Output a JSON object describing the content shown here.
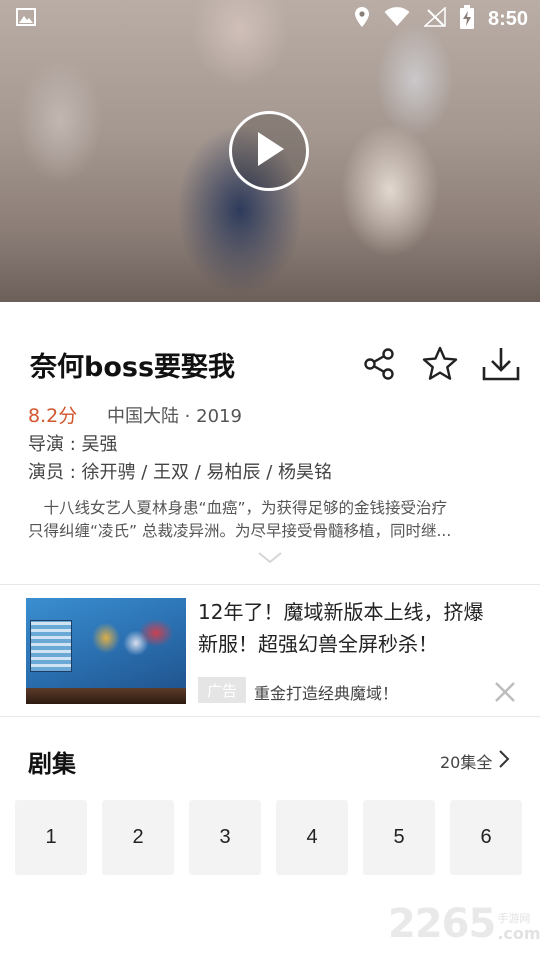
{
  "status_bar": {
    "time": "8:50",
    "icons": [
      "image-icon",
      "location-icon",
      "wifi-icon",
      "no-signal-icon",
      "battery-charging-icon"
    ]
  },
  "video": {
    "play_icon": "play-icon"
  },
  "show": {
    "title": "奈何boss要娶我",
    "rating": "8.2分",
    "region_year": "中国大陆 · 2019",
    "director": "导演 : 吴强",
    "cast": "演员 : 徐开骋 / 王双 / 易柏辰 / 杨昊铭",
    "description_line1": "　十八线女艺人夏林身患“血癌”，为获得足够的金钱接受治疗",
    "description_line2": "只得纠缠“凌氏” 总裁凌异洲。为尽早接受骨髓移植，同时继...",
    "actions": [
      "share-icon",
      "star-icon",
      "download-icon"
    ]
  },
  "ad": {
    "title_line1": "12年了！魔域新版本上线，挤爆",
    "title_line2": "新服！超强幻兽全屏秒杀！",
    "badge": "广告",
    "subtitle": "重金打造经典魔域！"
  },
  "episodes": {
    "title": "剧集",
    "total": "20集全",
    "items": [
      "1",
      "2",
      "3",
      "4",
      "5",
      "6"
    ]
  },
  "watermark": {
    "number": "2265",
    "site": "手游网",
    "domain": ".com"
  }
}
